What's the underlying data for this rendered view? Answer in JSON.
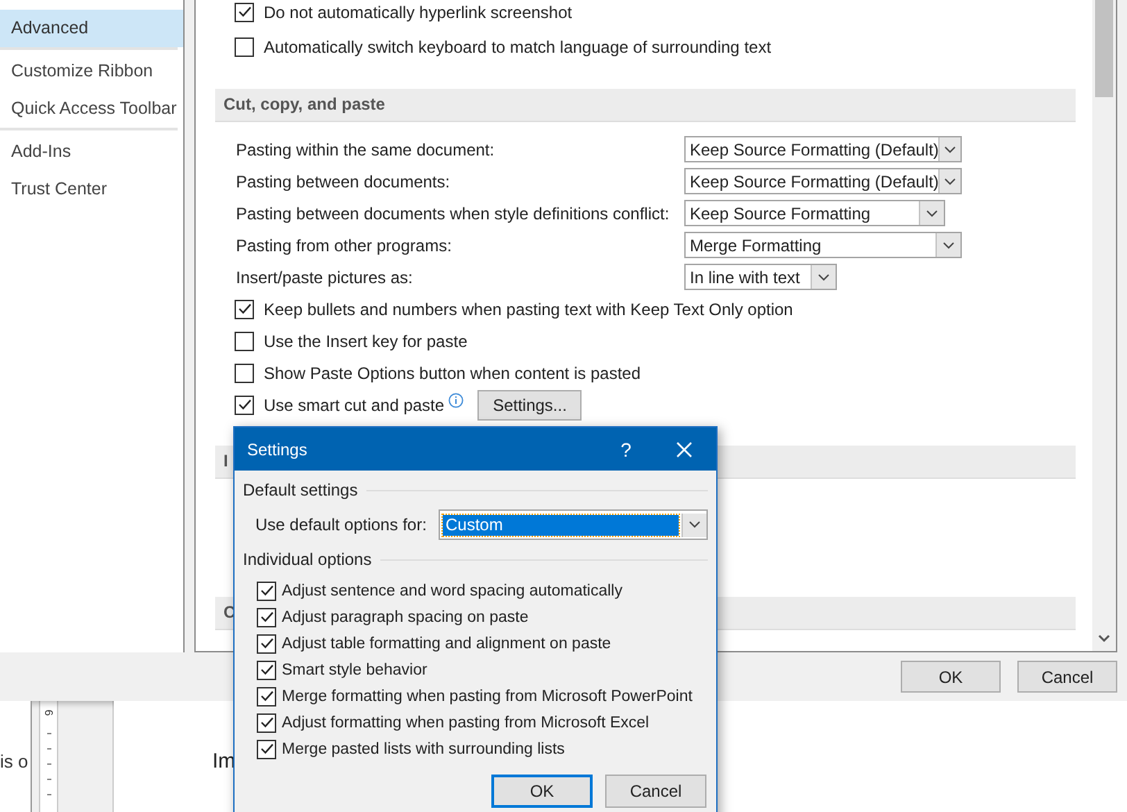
{
  "options_window": {
    "sidebar": {
      "items": [
        {
          "label": "Advanced",
          "selected": true
        },
        {
          "label": "Customize Ribbon",
          "selected": false
        },
        {
          "label": "Quick Access Toolbar",
          "selected": false
        },
        {
          "label": "Add-Ins",
          "selected": false
        },
        {
          "label": "Trust Center",
          "selected": false
        }
      ]
    },
    "content": [
      {
        "kind": "checkbox",
        "label": "Do not automatically hyperlink screenshot",
        "checked": true
      },
      {
        "kind": "checkbox",
        "label": "Automatically switch keyboard to match language of surrounding text",
        "checked": false
      },
      {
        "kind": "section",
        "label": "Cut, copy, and paste"
      },
      {
        "kind": "dropdown",
        "label": "Pasting within the same document:",
        "value": "Keep Source Formatting (Default)"
      },
      {
        "kind": "dropdown",
        "label": "Pasting between documents:",
        "value": "Keep Source Formatting (Default)"
      },
      {
        "kind": "dropdown",
        "label": "Pasting between documents when style definitions conflict:",
        "value": "Keep Source Formatting"
      },
      {
        "kind": "dropdown",
        "label": "Pasting from other programs:",
        "value": "Merge Formatting"
      },
      {
        "kind": "dropdown",
        "label": "Insert/paste pictures as:",
        "value": "In line with text"
      },
      {
        "kind": "checkbox",
        "label": "Keep bullets and numbers when pasting text with Keep Text Only option",
        "checked": true
      },
      {
        "kind": "checkbox",
        "label": "Use the Insert key for paste",
        "checked": false
      },
      {
        "kind": "checkbox",
        "label": "Show Paste Options button when content is pasted",
        "checked": false
      },
      {
        "kind": "checkbox",
        "label": "Use smart cut and paste",
        "checked": true,
        "button": "Settings..."
      },
      {
        "kind": "section",
        "label": "I"
      },
      {
        "kind": "section",
        "label": "C"
      }
    ],
    "buttons": [
      "OK",
      "Cancel"
    ]
  },
  "document": {
    "ruler_number": "6",
    "left_text": "is o",
    "page_text": "Im"
  },
  "settings_dialog": {
    "title": "Settings",
    "help": "?",
    "default_settings": {
      "heading": "Default settings",
      "label": "Use default options for:",
      "value": "Custom"
    },
    "individual_options": {
      "heading": "Individual options",
      "items": [
        {
          "label": "Adjust sentence and word spacing automatically",
          "checked": true
        },
        {
          "label": "Adjust paragraph spacing on paste",
          "checked": true
        },
        {
          "label": "Adjust table formatting and alignment on paste",
          "checked": true
        },
        {
          "label": "Smart style behavior",
          "checked": true
        },
        {
          "label": "Merge formatting when pasting from Microsoft PowerPoint",
          "checked": true
        },
        {
          "label": "Adjust formatting when pasting from Microsoft Excel",
          "checked": true
        },
        {
          "label": "Merge pasted lists with surrounding lists",
          "checked": true
        }
      ]
    },
    "buttons": [
      "OK",
      "Cancel"
    ]
  }
}
